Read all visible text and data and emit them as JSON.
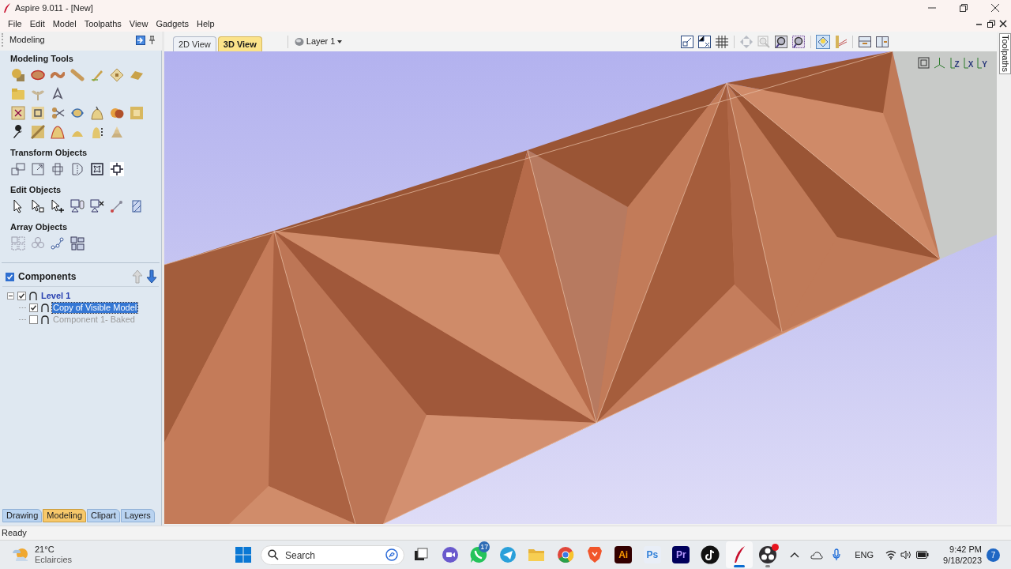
{
  "window": {
    "title": "Aspire 9.011 - [New]"
  },
  "menu": [
    "File",
    "Edit",
    "Model",
    "Toolpaths",
    "View",
    "Gadgets",
    "Help"
  ],
  "left_panel": {
    "title": "Modeling",
    "sections": [
      {
        "title": "Modeling Tools"
      },
      {
        "title": "Transform Objects"
      },
      {
        "title": "Edit Objects"
      },
      {
        "title": "Array Objects"
      }
    ],
    "components": {
      "title": "Components",
      "checked": true,
      "tree": [
        {
          "label": "Level 1",
          "checked": true,
          "expanded": true,
          "selected": false,
          "children": [
            {
              "label": "Copy of Visible Model",
              "checked": true,
              "selected": true
            },
            {
              "label": "Component 1- Baked",
              "checked": false,
              "selected": false
            }
          ]
        }
      ]
    },
    "bottom_tabs": [
      {
        "label": "Drawing",
        "selected": false
      },
      {
        "label": "Modeling",
        "selected": true
      },
      {
        "label": "Clipart",
        "selected": false
      },
      {
        "label": "Layers",
        "selected": false
      }
    ]
  },
  "view_tabs": [
    {
      "label": "2D View",
      "selected": false
    },
    {
      "label": "3D View",
      "selected": true
    }
  ],
  "layer_dropdown": {
    "value": "Layer 1"
  },
  "view_axes": [
    "Z",
    "X",
    "Y"
  ],
  "side_tab": {
    "label": "Toolpaths"
  },
  "status_bar": {
    "text": "Ready"
  },
  "taskbar": {
    "weather": {
      "temperature": "21°C",
      "condition": "Eclaircies"
    },
    "search": {
      "placeholder": "Search"
    },
    "apps": [
      {
        "kind": "taskview",
        "active": false,
        "running": false
      },
      {
        "kind": "meet",
        "active": false,
        "running": false
      },
      {
        "kind": "whatsapp",
        "active": false,
        "running": false,
        "badge": "17"
      },
      {
        "kind": "telegram",
        "active": false,
        "running": false
      },
      {
        "kind": "files",
        "active": false,
        "running": false
      },
      {
        "kind": "chrome",
        "active": false,
        "running": false
      },
      {
        "kind": "brave",
        "active": false,
        "running": false
      },
      {
        "kind": "illustrator",
        "label": "Ai",
        "active": false,
        "running": false
      },
      {
        "kind": "photoshop",
        "label": "Ps",
        "active": false,
        "running": false
      },
      {
        "kind": "premiere",
        "label": "Pr",
        "active": false,
        "running": false
      },
      {
        "kind": "tiktok",
        "active": false,
        "running": false
      },
      {
        "kind": "aspire",
        "active": true,
        "running": true
      },
      {
        "kind": "obs",
        "active": false,
        "running": true
      }
    ],
    "language": "ENG",
    "time": "9:42 PM",
    "date": "9/18/2023",
    "notification_count": "7"
  }
}
